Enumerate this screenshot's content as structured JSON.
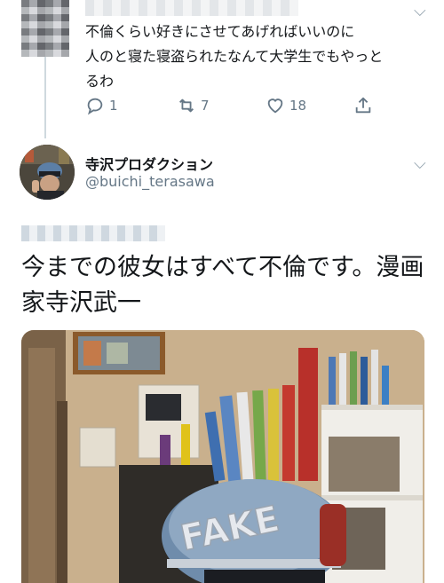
{
  "reply": {
    "text": "不倫くらい好きにさせてあげればいいのに\n人のと寝た寝盗られたなんて大学生でもやっと\nるわ",
    "stats": {
      "replies": "1",
      "retweets": "7",
      "likes": "18"
    }
  },
  "tweet": {
    "display_name": "寺沢プロダクション",
    "handle": "@buichi_terasawa",
    "text": "今までの彼女はすべて不倫です。漫画家寺沢武一"
  },
  "icons": {
    "reply": "reply-icon",
    "retweet": "retweet-icon",
    "like": "heart-icon",
    "share": "share-icon",
    "menu": "chevron-down-icon"
  },
  "colors": {
    "text": "#14171a",
    "secondary": "#657786",
    "thread_line": "#cfd9de"
  }
}
